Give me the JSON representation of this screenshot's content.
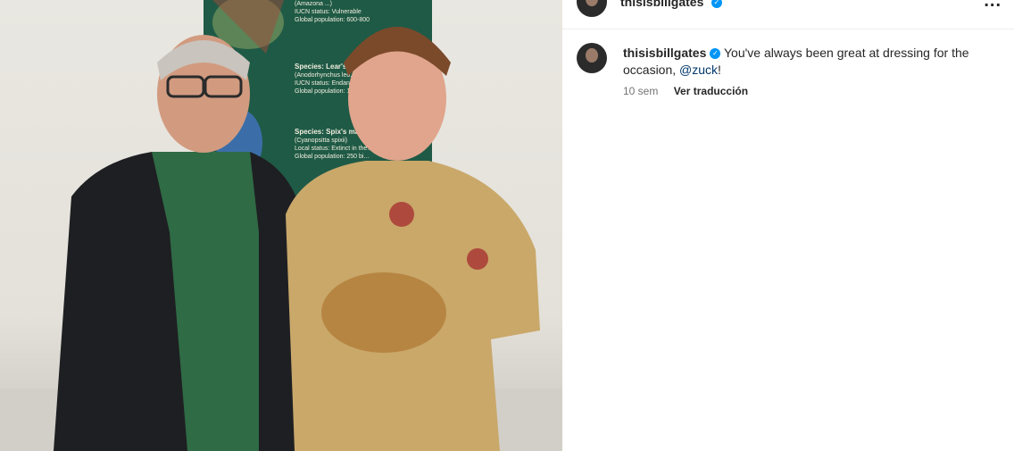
{
  "post": {
    "photo_alt": "",
    "poster": {
      "line1": "(Amazona ...)",
      "line2": "IUCN status: Vulnerable",
      "line3": "Global population: 600-800",
      "species2_title": "Species: Lear's mac...",
      "species2_latin": "(Anodorhynchus leo...",
      "species2_status": "IUCN status: Endangered",
      "species2_pop": "Global population: 1700 bi...",
      "species3_title": "Species: Spix's ma...",
      "species3_latin": "(Cyanopsitta spixii)",
      "species3_status": "Local status: Extinct in the...",
      "species3_pop": "Global population: 250 bi..."
    }
  },
  "header": {
    "username": "thisisbillgates",
    "more_label": "..."
  },
  "comment": {
    "username": "thisisbillgates",
    "text": "You've always been great at dressing for the occasion, ",
    "mention": "@zuck",
    "suffix": "!",
    "time": "10 sem",
    "translate_label": "Ver traducción"
  }
}
